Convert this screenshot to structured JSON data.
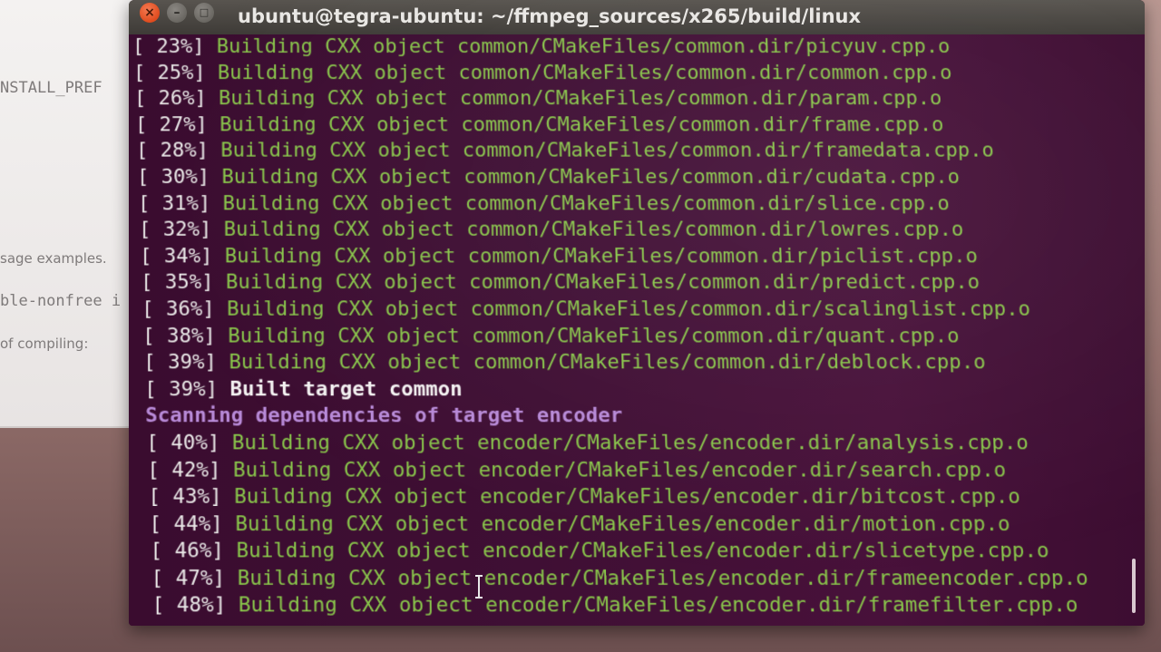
{
  "background_doc": {
    "fragments": [
      "NSTALL_PREF",
      "sage examples.",
      "ble-nonfree i",
      "of compiling:"
    ]
  },
  "window": {
    "title": "ubuntu@tegra-ubuntu: ~/ffmpeg_sources/x265/build/linux",
    "close_glyph": "×",
    "minimize_glyph": "–",
    "maximize_glyph": "□"
  },
  "terminal": {
    "lines": [
      {
        "kind": "build",
        "pct": "[ 23%]",
        "text": "Building CXX object common/CMakeFiles/common.dir/picyuv.cpp.o"
      },
      {
        "kind": "build",
        "pct": "[ 25%]",
        "text": "Building CXX object common/CMakeFiles/common.dir/common.cpp.o"
      },
      {
        "kind": "build",
        "pct": "[ 26%]",
        "text": "Building CXX object common/CMakeFiles/common.dir/param.cpp.o"
      },
      {
        "kind": "build",
        "pct": "[ 27%]",
        "text": "Building CXX object common/CMakeFiles/common.dir/frame.cpp.o"
      },
      {
        "kind": "build",
        "pct": "[ 28%]",
        "text": "Building CXX object common/CMakeFiles/common.dir/framedata.cpp.o"
      },
      {
        "kind": "build",
        "pct": "[ 30%]",
        "text": "Building CXX object common/CMakeFiles/common.dir/cudata.cpp.o"
      },
      {
        "kind": "build",
        "pct": "[ 31%]",
        "text": "Building CXX object common/CMakeFiles/common.dir/slice.cpp.o"
      },
      {
        "kind": "build",
        "pct": "[ 32%]",
        "text": "Building CXX object common/CMakeFiles/common.dir/lowres.cpp.o"
      },
      {
        "kind": "build",
        "pct": "[ 34%]",
        "text": "Building CXX object common/CMakeFiles/common.dir/piclist.cpp.o"
      },
      {
        "kind": "build",
        "pct": "[ 35%]",
        "text": "Building CXX object common/CMakeFiles/common.dir/predict.cpp.o"
      },
      {
        "kind": "build",
        "pct": "[ 36%]",
        "text": "Building CXX object common/CMakeFiles/common.dir/scalinglist.cpp.o"
      },
      {
        "kind": "build",
        "pct": "[ 38%]",
        "text": "Building CXX object common/CMakeFiles/common.dir/quant.cpp.o"
      },
      {
        "kind": "build",
        "pct": "[ 39%]",
        "text": "Building CXX object common/CMakeFiles/common.dir/deblock.cpp.o"
      },
      {
        "kind": "built",
        "pct": "[ 39%]",
        "text": "Built target common"
      },
      {
        "kind": "scan",
        "pct": "",
        "text": "Scanning dependencies of target encoder"
      },
      {
        "kind": "build",
        "pct": "[ 40%]",
        "text": "Building CXX object encoder/CMakeFiles/encoder.dir/analysis.cpp.o"
      },
      {
        "kind": "build",
        "pct": "[ 42%]",
        "text": "Building CXX object encoder/CMakeFiles/encoder.dir/search.cpp.o"
      },
      {
        "kind": "build",
        "pct": "[ 43%]",
        "text": "Building CXX object encoder/CMakeFiles/encoder.dir/bitcost.cpp.o"
      },
      {
        "kind": "build",
        "pct": "[ 44%]",
        "text": "Building CXX object encoder/CMakeFiles/encoder.dir/motion.cpp.o"
      },
      {
        "kind": "build",
        "pct": "[ 46%]",
        "text": "Building CXX object encoder/CMakeFiles/encoder.dir/slicetype.cpp.o"
      },
      {
        "kind": "build",
        "pct": "[ 47%]",
        "text": "Building CXX object encoder/CMakeFiles/encoder.dir/frameencoder.cpp.o"
      },
      {
        "kind": "build",
        "pct": "[ 48%]",
        "text": "Building CXX object encoder/CMakeFiles/encoder.dir/framefilter.cpp.o"
      }
    ]
  },
  "colors": {
    "terminal_bg": "#3f0f34",
    "build_text": "#88c44a",
    "scan_text": "#b88ad8",
    "percent_text": "#e8e6e6",
    "titlebar": "#4a4742"
  }
}
